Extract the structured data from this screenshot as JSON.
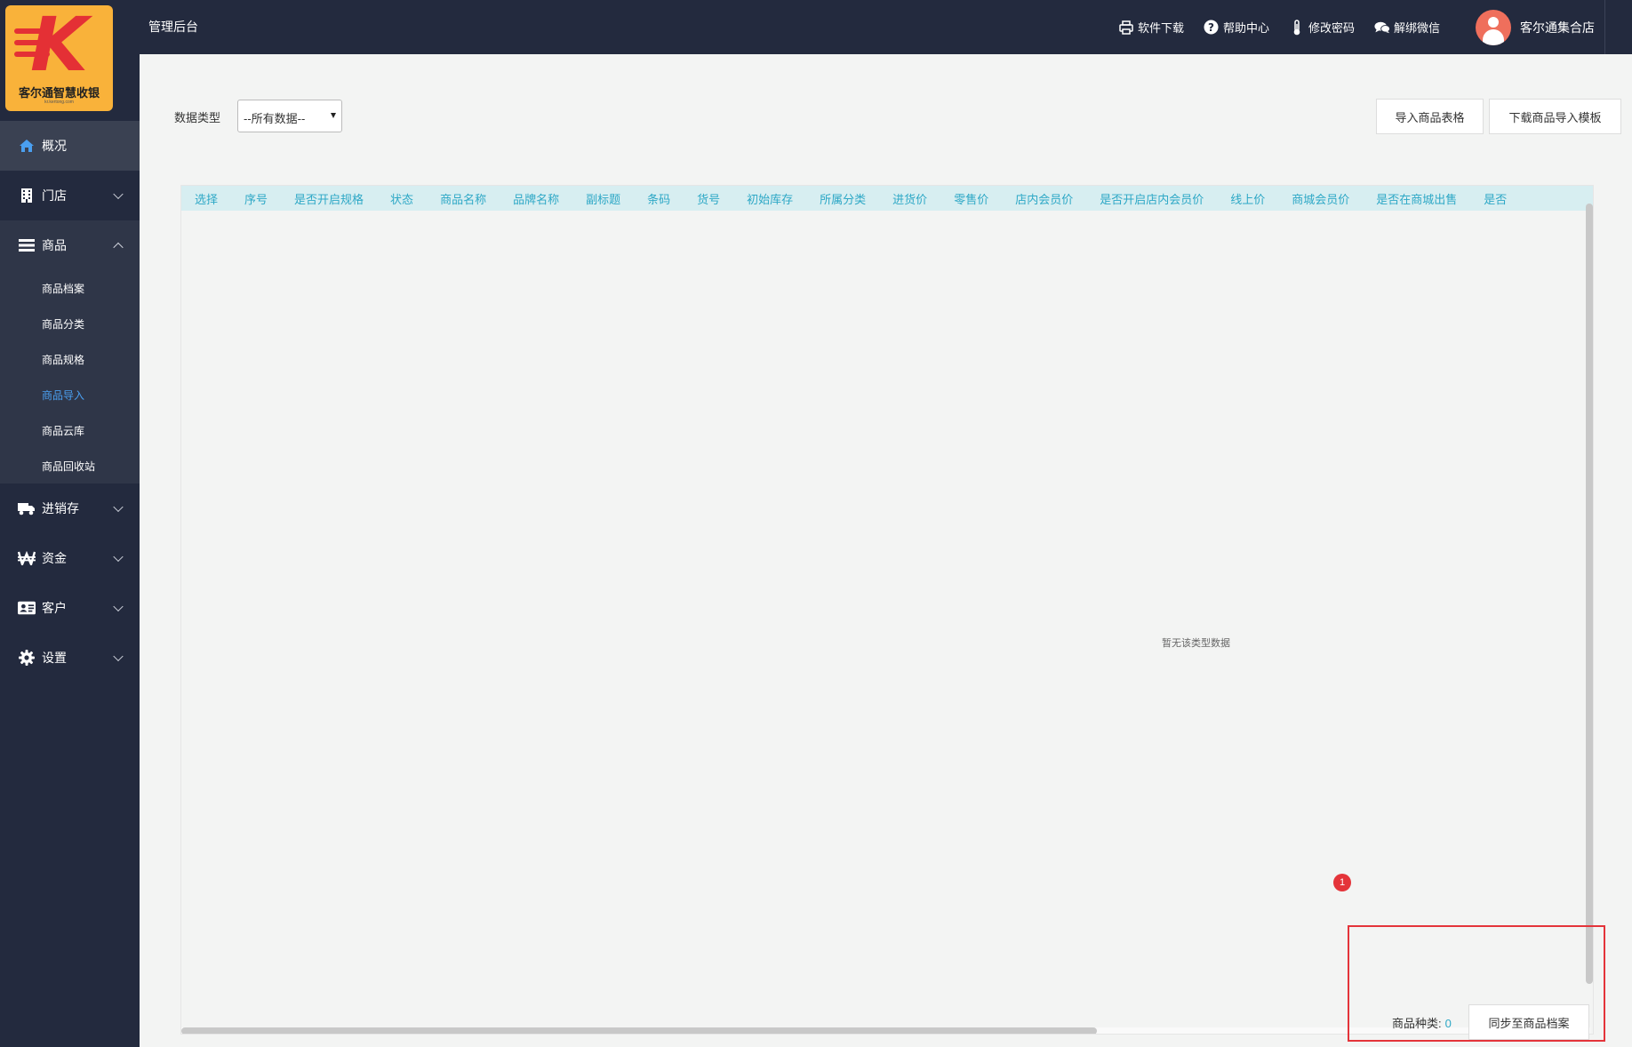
{
  "logo": {
    "letter": "K",
    "brand": "客尔通智慧收银",
    "domain": "kr.kertong.com"
  },
  "topbar": {
    "title": "管理后台",
    "links": [
      {
        "label": "软件下载",
        "icon": "printer-icon"
      },
      {
        "label": "帮助中心",
        "icon": "help-icon"
      },
      {
        "label": "修改密码",
        "icon": "thermometer-icon"
      },
      {
        "label": "解绑微信",
        "icon": "chat-icon"
      }
    ],
    "user_name": "客尔通集合店"
  },
  "sidebar": {
    "items": [
      {
        "label": "概况",
        "icon": "home-icon"
      },
      {
        "label": "门店",
        "icon": "building-icon"
      },
      {
        "label": "商品",
        "icon": "list-icon"
      },
      {
        "label": "进销存",
        "icon": "truck-icon"
      },
      {
        "label": "资金",
        "icon": "won-icon"
      },
      {
        "label": "客户",
        "icon": "id-card-icon"
      },
      {
        "label": "设置",
        "icon": "gear-icon"
      }
    ],
    "goods_submenu": [
      "商品档案",
      "商品分类",
      "商品规格",
      "商品导入",
      "商品云库",
      "商品回收站"
    ]
  },
  "filter": {
    "label": "数据类型",
    "selected": "--所有数据--"
  },
  "actions": {
    "import": "导入商品表格",
    "template": "下载商品导入模板"
  },
  "table": {
    "columns": [
      "选择",
      "序号",
      "是否开启规格",
      "状态",
      "商品名称",
      "品牌名称",
      "副标题",
      "条码",
      "货号",
      "初始库存",
      "所属分类",
      "进货价",
      "零售价",
      "店内会员价",
      "是否开启店内会员价",
      "线上价",
      "商城会员价",
      "是否在商城出售",
      "是否"
    ],
    "empty_text": "暂无该类型数据"
  },
  "badge": "1",
  "footer": {
    "count_label": "商品种类:",
    "count_value": "0",
    "sync_button": "同步至商品档案"
  },
  "colors": {
    "sidebar_bg": "#232a3e",
    "accent": "#2ea8c6",
    "active_link": "#4a9ff0",
    "alert": "#e4343a"
  }
}
